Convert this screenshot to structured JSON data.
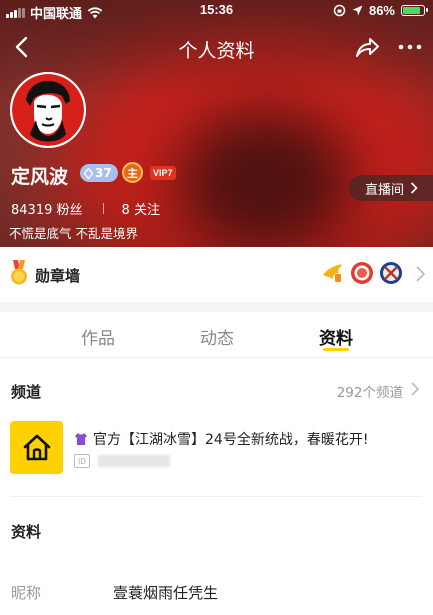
{
  "status_bar": {
    "carrier": "中国联通",
    "time": "15:36",
    "battery": "86%"
  },
  "nav": {
    "title": "个人资料"
  },
  "profile": {
    "name": "定风波",
    "level": "37",
    "host_badge": "主",
    "vip": "VIP7",
    "live_button": "直播间",
    "fans_count": "84319",
    "fans_label": "粉丝",
    "follow_count": "8",
    "follow_label": "关注",
    "bio": "不慌是底气 不乱是境界"
  },
  "medal": {
    "title": "勋章墙",
    "badges": [
      "wing-badge-icon",
      "red-ring-badge-icon",
      "blue-cross-badge-icon"
    ]
  },
  "tabs": [
    {
      "label": "作品",
      "active": false
    },
    {
      "label": "动态",
      "active": false
    },
    {
      "label": "资料",
      "active": true
    }
  ],
  "channel": {
    "section_title": "频道",
    "count_text": "292个频道",
    "item_title": "官方【江湖冰雪】24号全新统战，春暖花开!",
    "id_tag": "ID"
  },
  "info": {
    "section_title": "资料",
    "nickname_label": "昵称",
    "nickname_value": "壹蓑烟雨任凭生"
  },
  "colors": {
    "accent": "#ffd100",
    "hero_red": "#d8231d",
    "vip_red": "#e0341f",
    "level_blue": "#a8bff0"
  }
}
